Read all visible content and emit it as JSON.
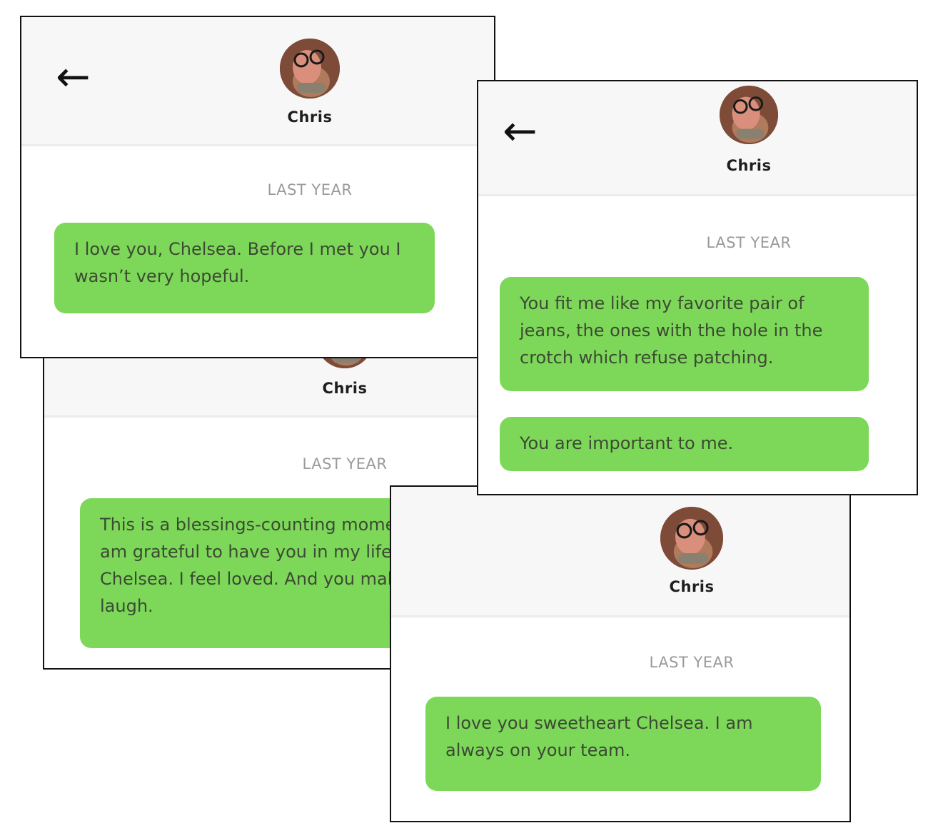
{
  "colors": {
    "bubble": "#7dd85a",
    "header_bg": "#f7f7f7",
    "date_text": "#9a9a9a"
  },
  "icons": {
    "back": "←"
  },
  "cards": [
    {
      "name": "Chris",
      "date_label": "LAST YEAR",
      "messages": [
        "This is a blessings-counting moment. I am grateful to have you in my life Chelsea. I feel loved. And you make me laugh."
      ]
    },
    {
      "name": "Chris",
      "date_label": "LAST YEAR",
      "messages": [
        "I love you sweetheart Chelsea. I am always on your team."
      ]
    },
    {
      "name": "Chris",
      "date_label": "LAST YEAR",
      "messages": [
        "I love you, Chelsea. Before I met you I wasn’t very hopeful."
      ]
    },
    {
      "name": "Chris",
      "date_label": "LAST YEAR",
      "messages": [
        "You fit me like my favorite pair of jeans, the ones with the hole in the crotch which refuse patching.",
        "You are important to me."
      ]
    }
  ]
}
